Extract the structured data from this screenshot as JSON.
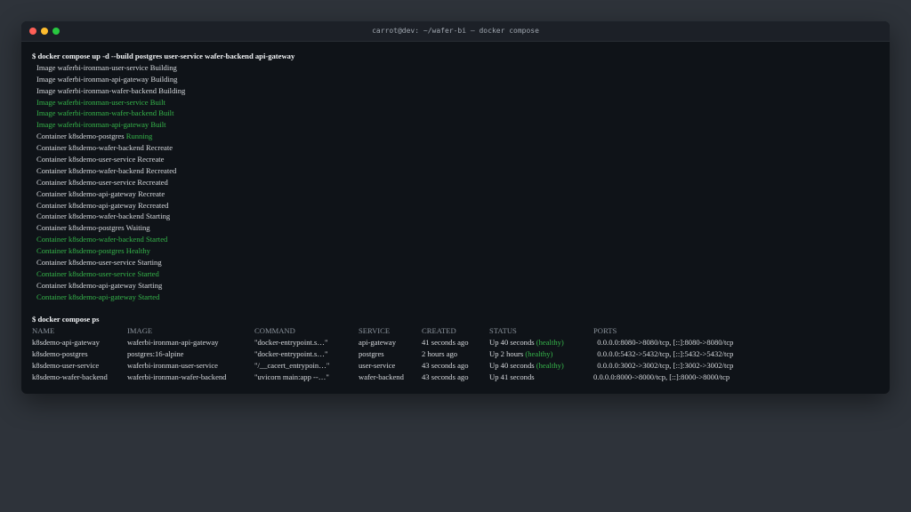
{
  "window": {
    "title": "carrot@dev: ~/wafer-bi — docker compose"
  },
  "colors": {
    "background": "#2e333a",
    "terminal_bg": "#0f1318",
    "text": "#d6d9dd",
    "success": "#35b44a"
  },
  "build": {
    "command": "$ docker compose up -d --build postgres user-service wafer-backend api-gateway",
    "lines": [
      {
        "prefix": "Image waferbi-ironman-user-service ",
        "status": "Building",
        "color": "white"
      },
      {
        "prefix": "Image waferbi-ironman-api-gateway ",
        "status": "Building",
        "color": "white"
      },
      {
        "prefix": "Image waferbi-ironman-wafer-backend ",
        "status": "Building",
        "color": "white"
      },
      {
        "prefix": "Image waferbi-ironman-user-service ",
        "status": "Built",
        "color": "green"
      },
      {
        "prefix": "Image waferbi-ironman-wafer-backend ",
        "status": "Built",
        "color": "green"
      },
      {
        "prefix": "Image waferbi-ironman-api-gateway ",
        "status": "Built",
        "color": "green"
      },
      {
        "prefix": "Container k8sdemo-postgres ",
        "status": "Running",
        "color": "status-green"
      },
      {
        "prefix": "Container k8sdemo-wafer-backend ",
        "status": "Recreate",
        "color": "white"
      },
      {
        "prefix": "Container k8sdemo-user-service ",
        "status": "Recreate",
        "color": "white"
      },
      {
        "prefix": "Container k8sdemo-wafer-backend ",
        "status": "Recreated",
        "color": "white"
      },
      {
        "prefix": "Container k8sdemo-user-service ",
        "status": "Recreated",
        "color": "white"
      },
      {
        "prefix": "Container k8sdemo-api-gateway ",
        "status": "Recreate",
        "color": "white"
      },
      {
        "prefix": "Container k8sdemo-api-gateway ",
        "status": "Recreated",
        "color": "white"
      },
      {
        "prefix": "Container k8sdemo-wafer-backend ",
        "status": "Starting",
        "color": "white"
      },
      {
        "prefix": "Container k8sdemo-postgres ",
        "status": "Waiting",
        "color": "white"
      },
      {
        "prefix": "Container k8sdemo-wafer-backend ",
        "status": "Started",
        "color": "green"
      },
      {
        "prefix": "Container k8sdemo-postgres ",
        "status": "Healthy",
        "color": "green"
      },
      {
        "prefix": "Container k8sdemo-user-service ",
        "status": "Starting",
        "color": "white"
      },
      {
        "prefix": "Container k8sdemo-user-service ",
        "status": "Started",
        "color": "green"
      },
      {
        "prefix": "Container k8sdemo-api-gateway ",
        "status": "Starting",
        "color": "white"
      },
      {
        "prefix": "Container k8sdemo-api-gateway ",
        "status": "Started",
        "color": "green"
      }
    ]
  },
  "ps": {
    "command": "$ docker compose ps",
    "headers": [
      "NAME",
      "IMAGE",
      "COMMAND",
      "SERVICE",
      "CREATED",
      "STATUS",
      "PORTS"
    ],
    "rows": [
      {
        "name": "k8sdemo-api-gateway",
        "image": "waferbi-ironman-api-gateway",
        "command": "\"docker-entrypoint.s…\"",
        "service": "api-gateway",
        "created": "41 seconds ago",
        "status": "Up 40 seconds ",
        "health": "(healthy)",
        "ports": "  0.0.0.0:8080->8080/tcp, [::]:8080->8080/tcp"
      },
      {
        "name": "k8sdemo-postgres",
        "image": "postgres:16-alpine",
        "command": "\"docker-entrypoint.s…\"",
        "service": "postgres",
        "created": "2 hours ago",
        "status": "Up 2 hours ",
        "health": "(healthy)",
        "ports": "  0.0.0.0:5432->5432/tcp, [::]:5432->5432/tcp"
      },
      {
        "name": "k8sdemo-user-service",
        "image": "waferbi-ironman-user-service",
        "command": "\"/__cacert_entrypoin…\"",
        "service": "user-service",
        "created": "43 seconds ago",
        "status": "Up 40 seconds ",
        "health": "(healthy)",
        "ports": "  0.0.0.0:3002->3002/tcp, [::]:3002->3002/tcp"
      },
      {
        "name": "k8sdemo-wafer-backend",
        "image": "waferbi-ironman-wafer-backend",
        "command": "\"uvicorn main:app --…\"",
        "service": "wafer-backend",
        "created": "43 seconds ago",
        "status": "Up 41 seconds",
        "health": "",
        "ports": "0.0.0.0:8000->8000/tcp, [::]:8000->8000/tcp"
      }
    ]
  }
}
